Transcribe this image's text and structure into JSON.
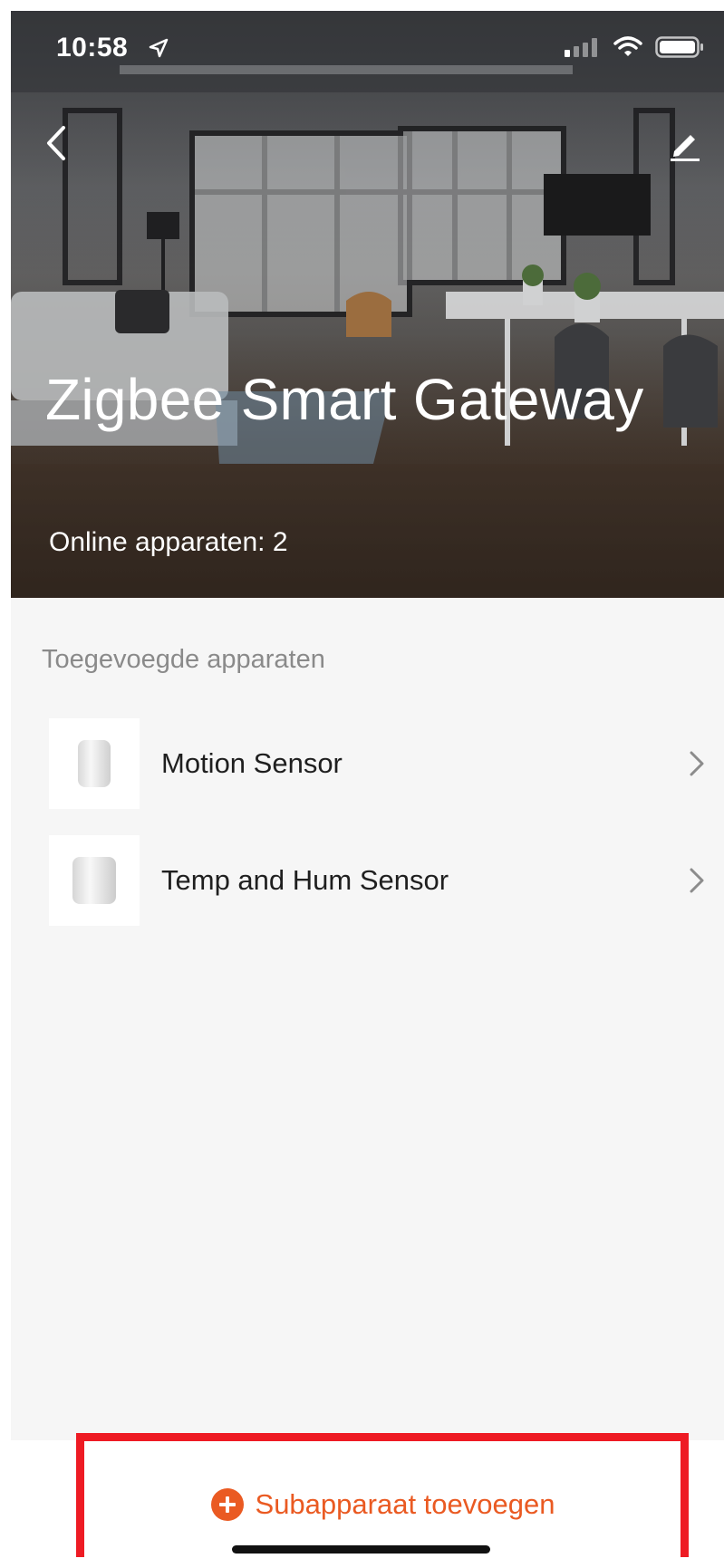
{
  "status_bar": {
    "time": "10:58"
  },
  "header": {
    "title": "Zigbee Smart Gateway",
    "online_text": "Online apparaten: 2"
  },
  "section": {
    "label": "Toegevoegde apparaten",
    "devices": [
      {
        "name": "Motion Sensor"
      },
      {
        "name": "Temp and Hum Sensor"
      }
    ]
  },
  "footer": {
    "add_label": "Subapparaat toevoegen"
  },
  "colors": {
    "accent": "#ea5a22",
    "highlight": "#ee1b24"
  }
}
